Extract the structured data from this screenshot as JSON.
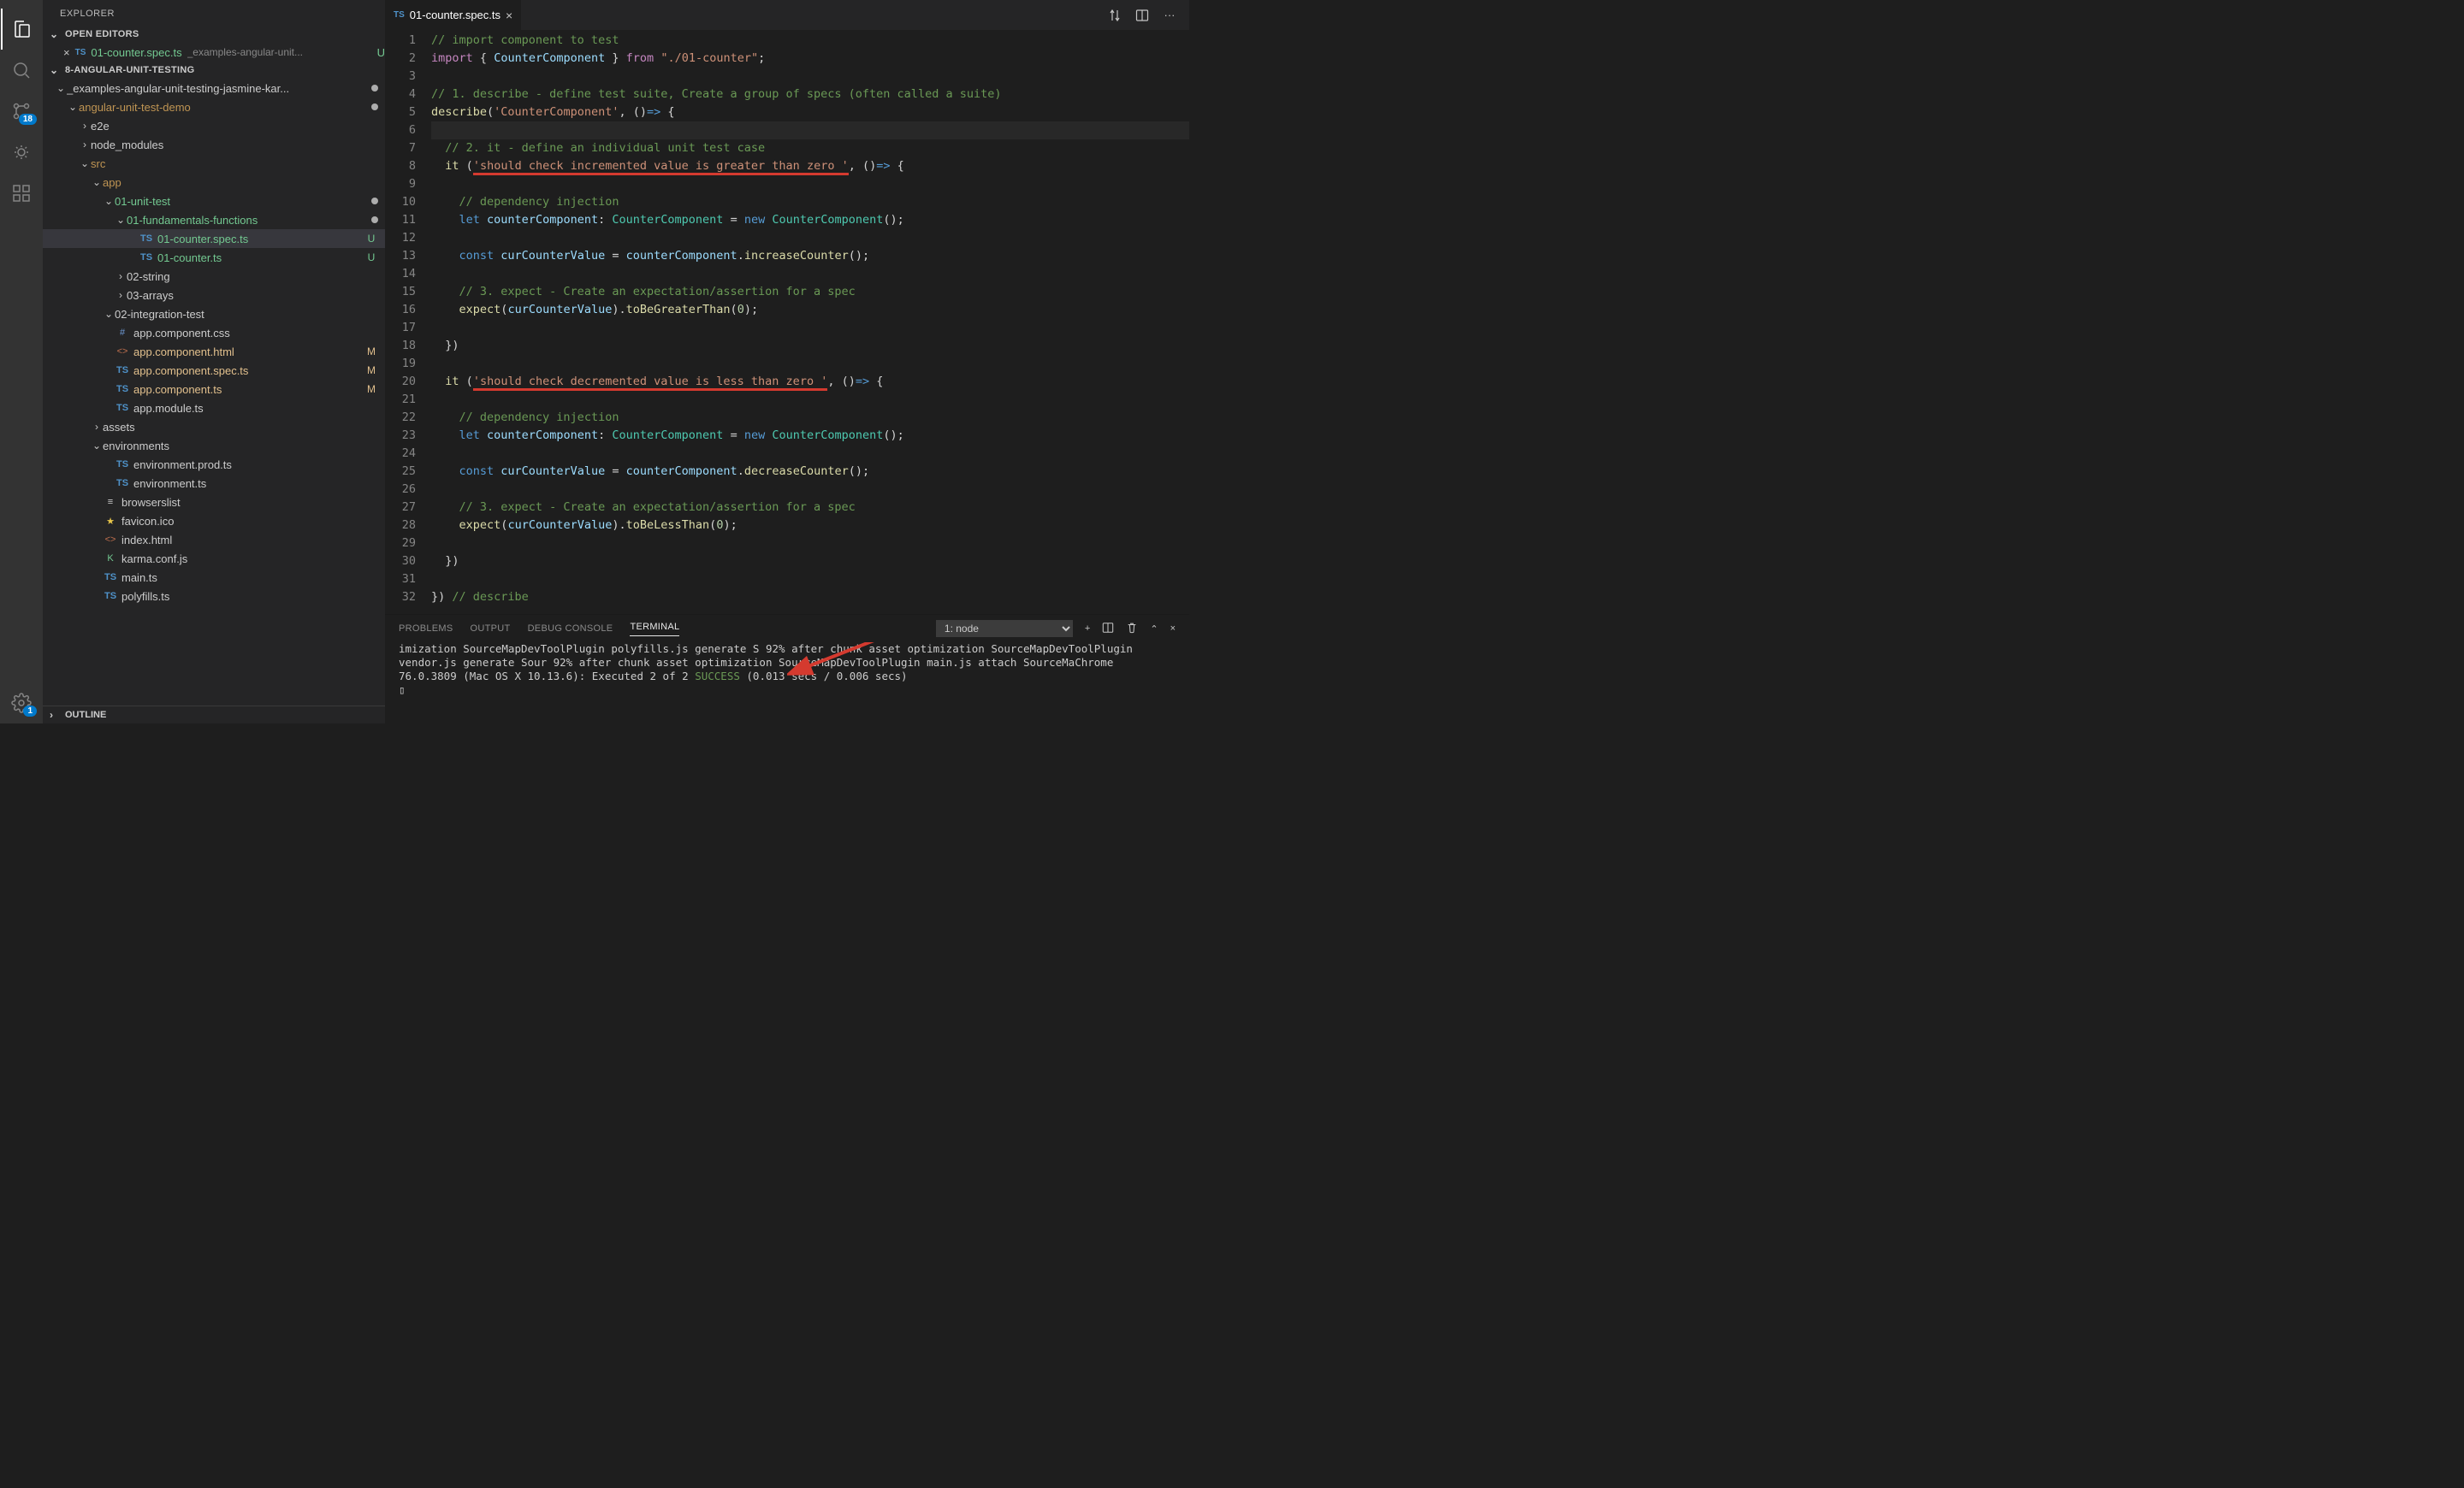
{
  "sidebar": {
    "title": "EXPLORER",
    "open_editors_label": "OPEN EDITORS",
    "open_file": {
      "name": "01-counter.spec.ts",
      "path": "_examples-angular-unit...",
      "status": "U"
    },
    "workspace_label": "8-ANGULAR-UNIT-TESTING",
    "outline_label": "OUTLINE",
    "scm_badge": "18",
    "gear_badge": "1",
    "tree": [
      {
        "depth": 0,
        "twisty": "v",
        "icon": "",
        "label": "_examples-angular-unit-testing-jasmine-kar...",
        "dot": true
      },
      {
        "depth": 1,
        "twisty": "v",
        "icon": "",
        "label": "angular-unit-test-demo",
        "dot": true,
        "cls": "c-fold"
      },
      {
        "depth": 2,
        "twisty": ">",
        "icon": "",
        "label": "e2e"
      },
      {
        "depth": 2,
        "twisty": ">",
        "icon": "",
        "label": "node_modules"
      },
      {
        "depth": 2,
        "twisty": "v",
        "icon": "",
        "label": "src",
        "cls": "c-fold"
      },
      {
        "depth": 3,
        "twisty": "v",
        "icon": "",
        "label": "app",
        "cls": "c-fold"
      },
      {
        "depth": 4,
        "twisty": "v",
        "icon": "",
        "label": "01-unit-test",
        "dot": true,
        "cls": "c-untracked"
      },
      {
        "depth": 5,
        "twisty": "v",
        "icon": "",
        "label": "01-fundamentals-functions",
        "dot": true,
        "cls": "c-untracked"
      },
      {
        "depth": 6,
        "icon": "TS",
        "iconcls": "c-ts",
        "label": "01-counter.spec.ts",
        "status": "U",
        "cls": "c-untracked",
        "selected": true
      },
      {
        "depth": 6,
        "icon": "TS",
        "iconcls": "c-ts",
        "label": "01-counter.ts",
        "status": "U",
        "cls": "c-untracked"
      },
      {
        "depth": 5,
        "twisty": ">",
        "icon": "",
        "label": "02-string"
      },
      {
        "depth": 5,
        "twisty": ">",
        "icon": "",
        "label": "03-arrays"
      },
      {
        "depth": 4,
        "twisty": "v",
        "icon": "",
        "label": "02-integration-test"
      },
      {
        "depth": 4,
        "icon": "#",
        "iconcls": "c-css",
        "label": "app.component.css"
      },
      {
        "depth": 4,
        "icon": "<>",
        "iconcls": "c-html",
        "label": "app.component.html",
        "status": "M",
        "cls": "c-mod"
      },
      {
        "depth": 4,
        "icon": "TS",
        "iconcls": "c-ts",
        "label": "app.component.spec.ts",
        "status": "M",
        "cls": "c-mod"
      },
      {
        "depth": 4,
        "icon": "TS",
        "iconcls": "c-ts",
        "label": "app.component.ts",
        "status": "M",
        "cls": "c-mod"
      },
      {
        "depth": 4,
        "icon": "TS",
        "iconcls": "c-ts",
        "label": "app.module.ts"
      },
      {
        "depth": 3,
        "twisty": ">",
        "icon": "",
        "label": "assets"
      },
      {
        "depth": 3,
        "twisty": "v",
        "icon": "",
        "label": "environments"
      },
      {
        "depth": 4,
        "icon": "TS",
        "iconcls": "c-ts",
        "label": "environment.prod.ts"
      },
      {
        "depth": 4,
        "icon": "TS",
        "iconcls": "c-ts",
        "label": "environment.ts"
      },
      {
        "depth": 3,
        "icon": "≡",
        "iconcls": "",
        "label": "browserslist"
      },
      {
        "depth": 3,
        "icon": "★",
        "iconcls": "c-star",
        "label": "favicon.ico"
      },
      {
        "depth": 3,
        "icon": "<>",
        "iconcls": "c-html",
        "label": "index.html"
      },
      {
        "depth": 3,
        "icon": "K",
        "iconcls": "c-untracked",
        "label": "karma.conf.js"
      },
      {
        "depth": 3,
        "icon": "TS",
        "iconcls": "c-ts",
        "label": "main.ts"
      },
      {
        "depth": 3,
        "icon": "TS",
        "iconcls": "c-ts",
        "label": "polyfills.ts"
      }
    ]
  },
  "tab": {
    "icon": "TS",
    "name": "01-counter.spec.ts"
  },
  "panel": {
    "tabs": [
      "PROBLEMS",
      "OUTPUT",
      "DEBUG CONSOLE",
      "TERMINAL"
    ],
    "active": 3,
    "selector": "1: node",
    "text_a": "imization SourceMapDevToolPlugin polyfills.js generate S 92% after chunk asset optimization SourceMapDevToolPlugin vendor.js generate Sour 92% after chunk asset optimization SourceMapDevToolPlugin main.js attach SourceMaChrome 76.0.3809 (Mac OS X 10.13.6): Executed 2 of 2 ",
    "text_success": "SUCCESS",
    "text_b": " (0.013 secs / 0.006 secs)",
    "prompt": "▯"
  },
  "code": {
    "lines": 32
  }
}
